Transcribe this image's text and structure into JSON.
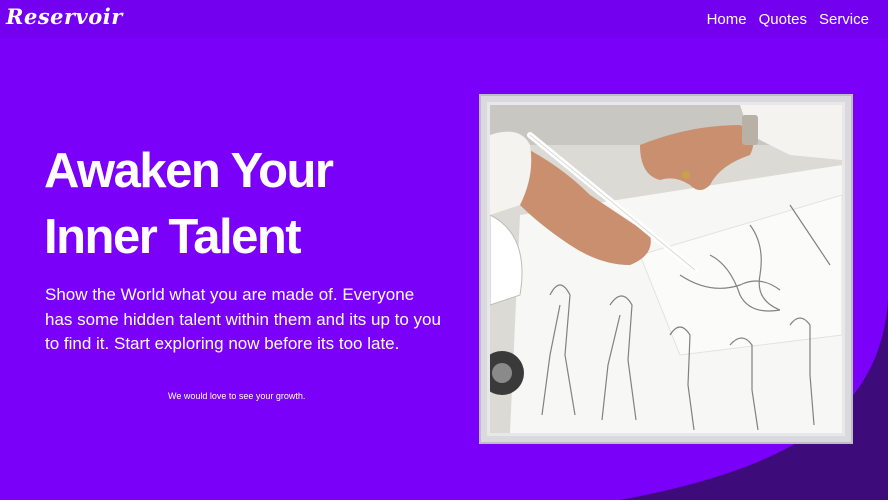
{
  "brand": {
    "name": "Reservoir"
  },
  "nav": {
    "items": [
      {
        "label": "Home"
      },
      {
        "label": "Quotes"
      },
      {
        "label": "Service"
      }
    ]
  },
  "hero": {
    "title_line1": "Awaken Your",
    "title_line2": "Inner Talent",
    "description": "Show the World what you are made of. Everyone has some hidden talent within them and its up to you to find it. Start exploring now before its too late.",
    "note": "We would love to see your growth."
  },
  "image": {
    "subject": "hand-sketching-fashion-figures-photo"
  },
  "colors": {
    "background": "#7a00fa",
    "navbar": "#7300ee",
    "wave": "#3d0b7a",
    "text": "#ffffff"
  }
}
